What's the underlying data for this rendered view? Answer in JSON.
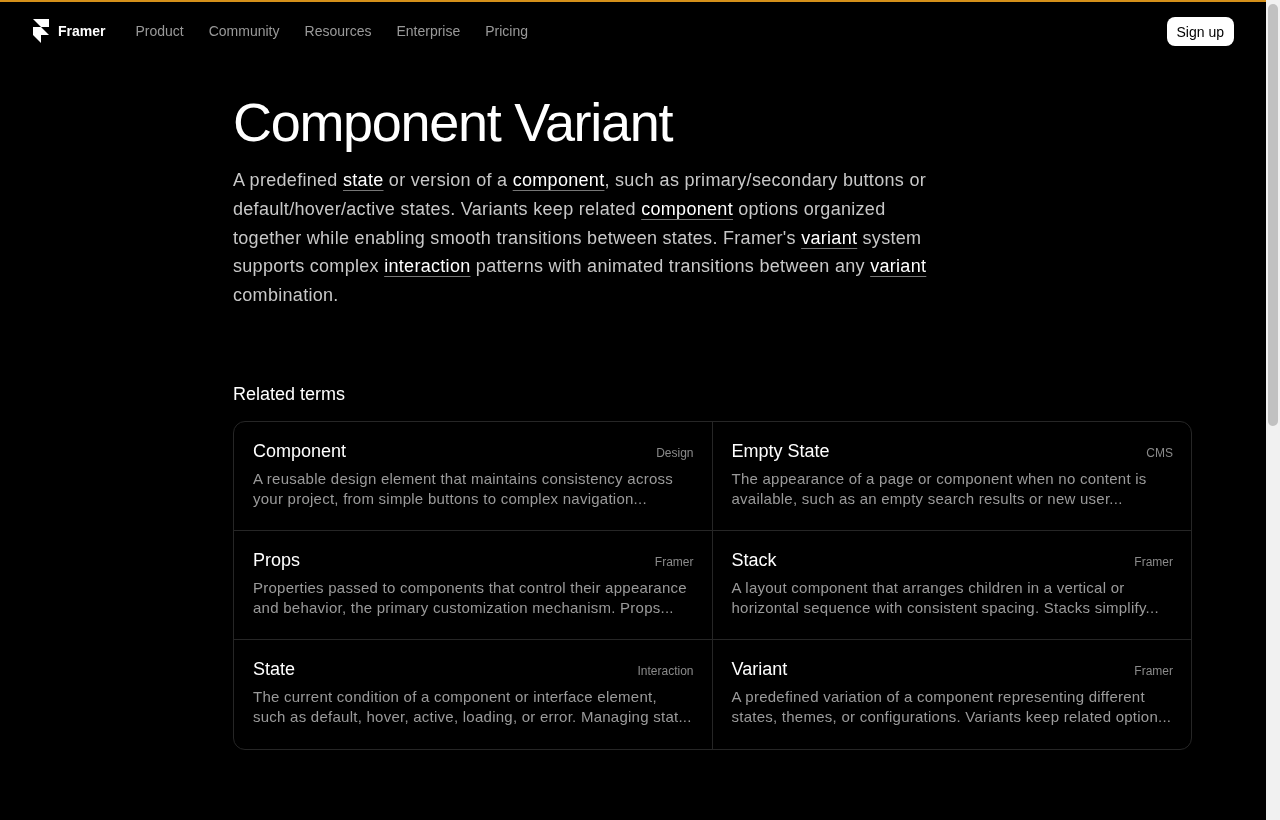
{
  "nav": {
    "brand": "Framer",
    "links": [
      "Product",
      "Community",
      "Resources",
      "Enterprise",
      "Pricing"
    ],
    "signup": "Sign up"
  },
  "title": "Component Variant",
  "definition": [
    {
      "kind": "text",
      "text": "A predefined "
    },
    {
      "kind": "link",
      "text": "state"
    },
    {
      "kind": "text",
      "text": " or version of a "
    },
    {
      "kind": "link",
      "text": "component"
    },
    {
      "kind": "text",
      "text": ", such as primary/secondary buttons or default/hover/active states. Variants keep related "
    },
    {
      "kind": "link",
      "text": "component"
    },
    {
      "kind": "text",
      "text": " options organized together while enabling smooth transitions between states. Framer's "
    },
    {
      "kind": "link",
      "text": "variant"
    },
    {
      "kind": "text",
      "text": " system supports complex "
    },
    {
      "kind": "link",
      "text": "interaction"
    },
    {
      "kind": "text",
      "text": " patterns with animated transitions between any "
    },
    {
      "kind": "link",
      "text": "variant"
    },
    {
      "kind": "text",
      "text": " combination."
    }
  ],
  "related": {
    "heading": "Related terms",
    "terms": [
      {
        "name": "Component",
        "category": "Design",
        "description": "A reusable design element that maintains consistency across your project, from simple buttons to complex navigation..."
      },
      {
        "name": "Empty State",
        "category": "CMS",
        "description": "The appearance of a page or component when no content is available, such as an empty search results or new user..."
      },
      {
        "name": "Props",
        "category": "Framer",
        "description": "Properties passed to components that control their appearance and behavior, the primary customization mechanism. Props..."
      },
      {
        "name": "Stack",
        "category": "Framer",
        "description": "A layout component that arranges children in a vertical or horizontal sequence with consistent spacing. Stacks simplify..."
      },
      {
        "name": "State",
        "category": "Interaction",
        "description": "The current condition of a component or interface element, such as default, hover, active, loading, or error. Managing stat..."
      },
      {
        "name": "Variant",
        "category": "Framer",
        "description": "A predefined variation of a component representing different states, themes, or configurations. Variants keep related option..."
      }
    ]
  }
}
